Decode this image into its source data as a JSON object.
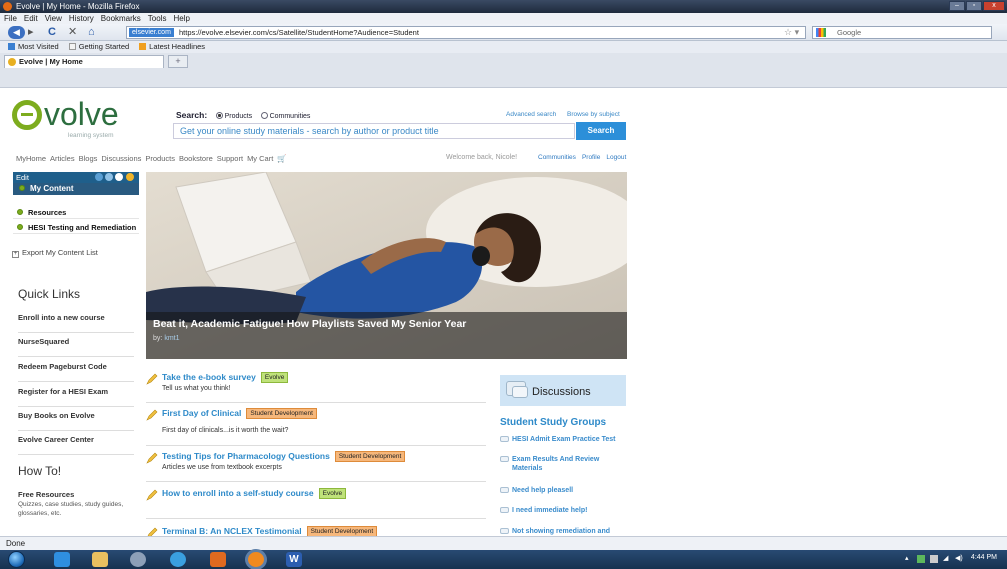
{
  "window": {
    "title": "Evolve | My Home - Mozilla Firefox",
    "buttons": [
      "–",
      "▫",
      "x"
    ]
  },
  "menu": [
    "File",
    "Edit",
    "View",
    "History",
    "Bookmarks",
    "Tools",
    "Help"
  ],
  "nav": {
    "site_badge": "elsevier.com",
    "url": "https://evolve.elsevier.com/cs/Satellite/StudentHome?Audience=Student",
    "search_placeholder": "Google"
  },
  "bookmarks": [
    "Most Visited",
    "Getting Started",
    "Latest Headlines"
  ],
  "tab": {
    "title": "Evolve | My Home",
    "new_tab": "+"
  },
  "page": {
    "logo": {
      "word": "volve",
      "sub": "learning system"
    },
    "search": {
      "label": "Search:",
      "opt_products": "Products",
      "opt_communities": "Communities",
      "advanced": "Advanced search",
      "browse": "Browse by subject",
      "placeholder": "Get your online study materials - search by author or product title",
      "button": "Search"
    },
    "sitenav": [
      "MyHome",
      "Articles",
      "Blogs",
      "Discussions",
      "Products",
      "Bookstore",
      "Support",
      "My Cart"
    ],
    "welcome": "Welcome back, Nicole!",
    "userlinks": [
      "Communities",
      "Profile",
      "Logout"
    ],
    "left": {
      "edit": "Edit",
      "my_content": "My Content",
      "items": [
        "Resources",
        "HESI Testing and Remediation"
      ],
      "export": "Export My Content List",
      "quick_links_title": "Quick Links",
      "quick_links": [
        "Enroll into a new course",
        "NurseSquared",
        "Redeem Pageburst Code",
        "Register for a HESI Exam",
        "Buy Books on Evolve",
        "Evolve Career Center"
      ],
      "howto_title": "How To!",
      "free_resources": {
        "title": "Free Resources",
        "desc": "Quizzes, case studies, study guides, glossaries, etc."
      }
    },
    "hero": {
      "title": "Beat it, Academic Fatigue! How Playlists Saved My Senior Year",
      "by": "by:",
      "author": "kmt1"
    },
    "articles": [
      {
        "title": "Take the e-book survey",
        "tag": "Evolve",
        "desc": "Tell us what you think!"
      },
      {
        "title": "First Day of Clinical",
        "tag": "Student Development",
        "desc": "First day of clinicals...is it worth the wait?"
      },
      {
        "title": "Testing Tips for Pharmacology Questions",
        "tag": "Student Development",
        "desc": "Articles we use from textbook excerpts"
      },
      {
        "title": "How to enroll into a self-study course",
        "tag": "Evolve",
        "desc": ""
      },
      {
        "title": "Terminal B: An NCLEX Testimonial",
        "tag": "Student Development",
        "desc": ""
      }
    ],
    "discussions": {
      "title": "Discussions",
      "group": "Student Study Groups",
      "items": [
        "HESI Admit Exam Practice Test",
        "Exam Results And Review Materials",
        "Need help pleasell",
        "I need immediate help!",
        "Not showing remediation and"
      ]
    }
  },
  "status": "Done",
  "clock": {
    "time": "4:44 PM"
  },
  "colors": {
    "brand_green": "#7dac1e",
    "link_blue": "#2e8ac9",
    "nav_dark": "#1f5f8b",
    "search_btn": "#2c8fd9"
  }
}
